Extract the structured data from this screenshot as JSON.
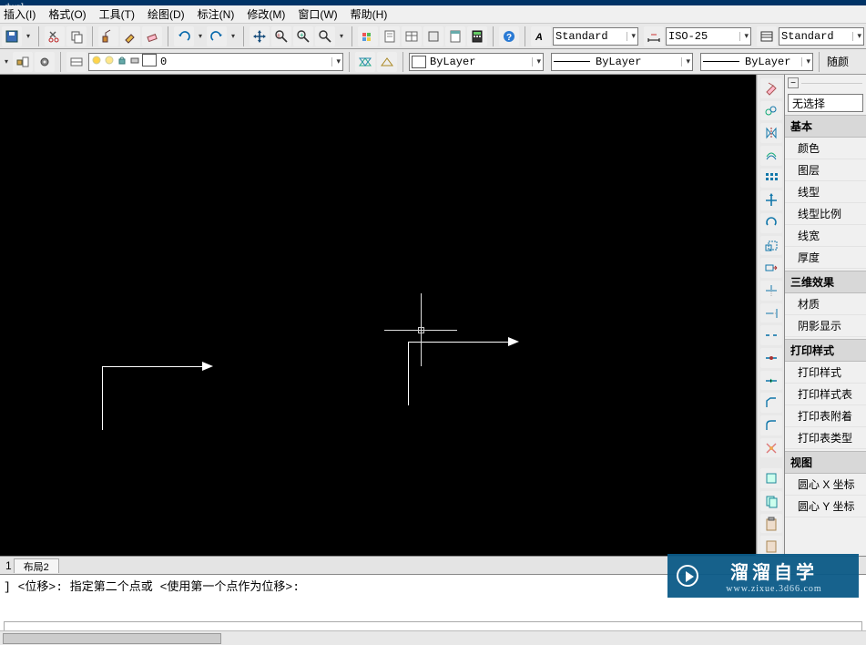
{
  "title_fragment": ".dwg]",
  "menu": [
    "插入(I)",
    "格式(O)",
    "工具(T)",
    "绘图(D)",
    "标注(N)",
    "修改(M)",
    "窗口(W)",
    "帮助(H)"
  ],
  "styles": {
    "text_style": "Standard",
    "dim_style": "ISO-25",
    "table_style": "Standard"
  },
  "layer": {
    "current": "0",
    "bylayer_label": "ByLayer"
  },
  "linetype": {
    "label": "ByLayer"
  },
  "lineweight": {
    "label": "ByLayer"
  },
  "extra_btn": "随颜",
  "properties": {
    "selection": "无选择",
    "groups": [
      {
        "title": "基本",
        "rows": [
          "颜色",
          "图层",
          "线型",
          "线型比例",
          "线宽",
          "厚度"
        ]
      },
      {
        "title": "三维效果",
        "rows": [
          "材质",
          "阴影显示"
        ]
      },
      {
        "title": "打印样式",
        "rows": [
          "打印样式",
          "打印样式表",
          "打印表附着",
          "打印表类型"
        ]
      },
      {
        "title": "视图",
        "rows": [
          "圆心 X 坐标",
          "圆心 Y 坐标"
        ]
      }
    ]
  },
  "tabs": [
    "布局2"
  ],
  "leading_tab_fragment": "1",
  "command": {
    "history_line": "] <位移>:  指定第二个点或  <使用第一个点作为位移>:"
  },
  "watermark": {
    "big": "溜溜自学",
    "small": "www.zixue.3d66.com"
  },
  "icons": {
    "dropdown_arrow": "▾"
  }
}
